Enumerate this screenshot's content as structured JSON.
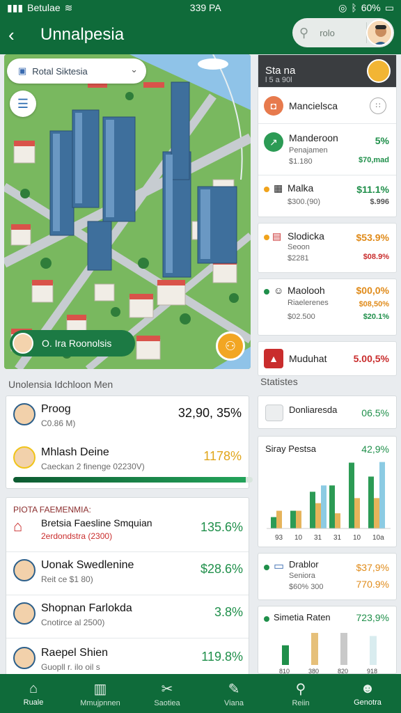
{
  "status_bar": {
    "carrier": "Betulae",
    "time": "339 PA",
    "battery": "60%"
  },
  "app_bar": {
    "title": "Unnalpesia",
    "search_text": "rolo"
  },
  "map": {
    "region_select": "Rotal Siktesia",
    "bottom_chip": "O. Ira Roonolsis"
  },
  "right_panel": {
    "header_title": "Sta na",
    "header_sub": "l 5 a 90l",
    "rows": [
      {
        "title": "Mancielsca",
        "icon": "bag-icon",
        "icon_color": "#e77a4d"
      },
      {
        "title": "Manderoon",
        "sub1": "Penajamen",
        "sub2": "$1.180",
        "value1": "5%",
        "value2": "$70,mad",
        "icon": "chart-icon",
        "icon_color": "#2c9b55"
      },
      {
        "title": "Malka",
        "sub1": "$300.(90)",
        "value1": "$11.1%",
        "value2": "$.996",
        "dot_color": "#f0a31c"
      },
      {
        "title": "Slodicka",
        "sub1": "Seoon",
        "sub2": "$2281",
        "value1": "$53.9%",
        "value2": "$08.9%",
        "dot_color": "#f0a31c",
        "value_color": "#e08b1a"
      },
      {
        "title": "Maolooh",
        "sub1": "Riaelerenes",
        "sub2": "$02.500",
        "value1": "$00,0%",
        "value2": "$08,50%",
        "value3": "$20.1%",
        "dot_color": "#1f8f4a",
        "value_color": "#e08b1a"
      },
      {
        "title": "Muduhat",
        "value1": "5.00,5%",
        "icon": "warning-icon",
        "icon_color": "#c92d2d",
        "value_color": "#c92d2d"
      }
    ]
  },
  "left_section_label": "Unolensia Idchloon Men",
  "right_section_label": "Statistes",
  "top_card": {
    "rows": [
      {
        "name": "Proog",
        "meta": "C0.86 M)",
        "value": "32,90, 35%",
        "value_color": "#111"
      },
      {
        "name": "Mhlash Deine",
        "meta": "Caeckan 2 finenge 02230V)",
        "value": "1178%",
        "value_color": "#e0a51a"
      }
    ],
    "progress_fraction": 0.97
  },
  "list_card": {
    "header": "PIOTA FAEMENMIA:",
    "rows": [
      {
        "name": "Bretsia Faesline Smquian",
        "meta": "2erdondstra (2300)",
        "value": "135.6%"
      },
      {
        "name": "Uonak Swedlenine",
        "meta": "Reit ce $1 80)",
        "value": "$28.6%"
      },
      {
        "name": "Shopnan Farlokda",
        "meta": "Cnotirce al 2500)",
        "value": "3.8%"
      },
      {
        "name": "Raepel Shien",
        "meta": "Guopll r. ilo oil s",
        "value": "119.8%"
      }
    ]
  },
  "stats_top": {
    "title": "Donliaresda",
    "value": "06.5%"
  },
  "chart_card": {
    "title": "Siray Pestsa",
    "value": "42,9%",
    "chart_data": {
      "type": "bar",
      "categories": [
        "93",
        "10",
        "31",
        "31",
        "10",
        "10a"
      ],
      "series": [
        {
          "values": [
            18,
            28,
            58,
            68,
            104,
            82
          ]
        },
        {
          "values": [
            28,
            28,
            40,
            24,
            48,
            48
          ]
        },
        {
          "values": [
            0,
            0,
            68,
            0,
            0,
            105
          ]
        }
      ],
      "colors": [
        "#2c9b55",
        "#e6b45b",
        "#8ccbe3"
      ]
    }
  },
  "dtablor": {
    "title": "Drablor",
    "sub1": "Seniora",
    "sub2": "$60% 300",
    "value1": "$37,9%",
    "value2": "770.9%"
  },
  "simetia": {
    "title": "Simetia Raten",
    "value": "723,9%",
    "categories": [
      "810",
      "380",
      "820",
      "918"
    ],
    "bars": [
      {
        "values": [
          38,
          0
        ]
      },
      {
        "values": [
          62,
          0
        ]
      },
      {
        "values": [
          62,
          0
        ]
      },
      {
        "values": [
          56,
          0
        ]
      }
    ],
    "colors": [
      "#1f8f4a",
      "#e6c07a",
      "#c9c9c9",
      "#d9ecef"
    ]
  },
  "bottom_nav": [
    {
      "label": "Ruale",
      "icon": "home-icon"
    },
    {
      "label": "Mmujpnnen",
      "icon": "book-icon"
    },
    {
      "label": "Saotiea",
      "icon": "tools-icon"
    },
    {
      "label": "Viana",
      "icon": "pen-icon"
    },
    {
      "label": "Reiin",
      "icon": "search-icon"
    },
    {
      "label": "Genotra",
      "icon": "profile-icon"
    }
  ]
}
